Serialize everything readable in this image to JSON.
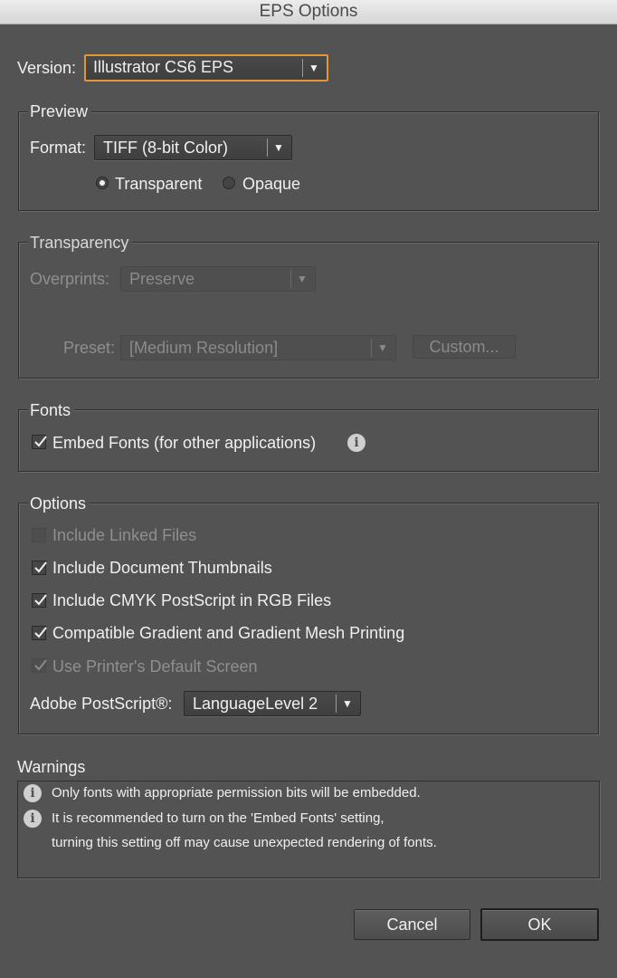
{
  "window": {
    "title": "EPS Options"
  },
  "version": {
    "label": "Version:",
    "value": "Illustrator CS6 EPS"
  },
  "preview": {
    "legend": "Preview",
    "format_label": "Format:",
    "format_value": "TIFF (8-bit Color)",
    "radio_transparent": "Transparent",
    "radio_opaque": "Opaque",
    "selected": "Transparent"
  },
  "transparency": {
    "legend": "Transparency",
    "overprints_label": "Overprints:",
    "overprints_value": "Preserve",
    "preset_label": "Preset:",
    "preset_value": "[Medium Resolution]",
    "custom_button": "Custom..."
  },
  "fonts": {
    "legend": "Fonts",
    "embed_fonts": {
      "label": "Embed Fonts (for other applications)",
      "checked": true
    }
  },
  "options": {
    "legend": "Options",
    "items": [
      {
        "label": "Include Linked Files",
        "checked": false,
        "enabled": false
      },
      {
        "label": "Include Document Thumbnails",
        "checked": true,
        "enabled": true
      },
      {
        "label": "Include CMYK PostScript in RGB Files",
        "checked": true,
        "enabled": true
      },
      {
        "label": "Compatible Gradient and Gradient Mesh Printing",
        "checked": true,
        "enabled": true
      },
      {
        "label": "Use Printer's Default Screen",
        "checked": true,
        "enabled": false
      }
    ],
    "postscript_label": "Adobe PostScript®:",
    "postscript_value": "LanguageLevel 2"
  },
  "warnings": {
    "legend": "Warnings",
    "line1": "Only fonts with appropriate permission bits will be embedded.",
    "line2": "It is recommended to turn on the 'Embed Fonts' setting,",
    "line3": "turning this setting off may cause unexpected rendering of fonts."
  },
  "buttons": {
    "cancel": "Cancel",
    "ok": "OK"
  },
  "colors": {
    "background": "#535353",
    "focus_ring": "#e3953a",
    "text": "#f0f0f0",
    "disabled_text": "#8a8a8a"
  }
}
